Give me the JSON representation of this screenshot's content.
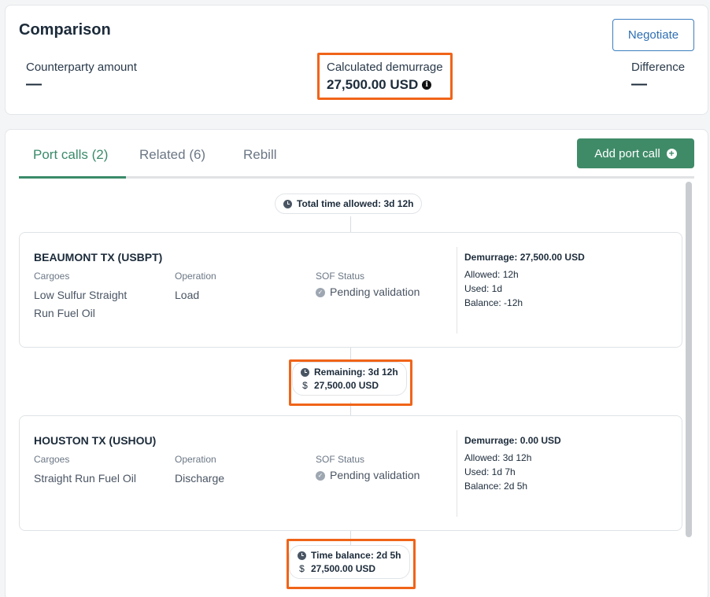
{
  "comparison": {
    "title": "Comparison",
    "negotiate_label": "Negotiate",
    "counterparty_label": "Counterparty amount",
    "counterparty_value": "—",
    "calculated_label": "Calculated demurrage",
    "calculated_value": "27,500.00 USD",
    "difference_label": "Difference",
    "difference_value": "—"
  },
  "tabs": [
    {
      "label": "Port calls (2)",
      "active": true
    },
    {
      "label": "Related (6)",
      "active": false
    },
    {
      "label": "Rebill",
      "active": false
    }
  ],
  "add_port_call_label": "Add port call",
  "total_time_allowed": "Total time allowed: 3d 12h",
  "port_calls": [
    {
      "name": "BEAUMONT TX (USBPT)",
      "cargoes_label": "Cargoes",
      "cargoes_line1": "Low Sulfur Straight",
      "cargoes_line2": "Run Fuel Oil",
      "operation_label": "Operation",
      "operation": "Load",
      "sof_label": "SOF Status",
      "sof_status": "Pending validation",
      "demurrage": "Demurrage: 27,500.00 USD",
      "allowed": "Allowed: 12h",
      "used": "Used: 1d",
      "balance": "Balance: -12h"
    },
    {
      "name": "HOUSTON TX (USHOU)",
      "cargoes_label": "Cargoes",
      "cargoes_line1": "Straight Run Fuel Oil",
      "cargoes_line2": "",
      "operation_label": "Operation",
      "operation": "Discharge",
      "sof_label": "SOF Status",
      "sof_status": "Pending validation",
      "demurrage": "Demurrage: 0.00 USD",
      "allowed": "Allowed: 3d 12h",
      "used": "Used: 1d 7h",
      "balance": "Balance: 2d 5h"
    }
  ],
  "remaining": {
    "time": "Remaining: 3d 12h",
    "amount": "27,500.00 USD"
  },
  "time_balance": {
    "time": "Time balance: 2d 5h",
    "amount": "27,500.00 USD"
  },
  "dollar_symbol": "$",
  "colors": {
    "accent_green": "#3f8b68",
    "highlight": "#f06418",
    "link_blue": "#2f6fb3"
  },
  "icons": {
    "info": "info-icon",
    "clock": "clock-icon",
    "check": "check-badge-icon",
    "plus": "plus-circle-icon"
  }
}
